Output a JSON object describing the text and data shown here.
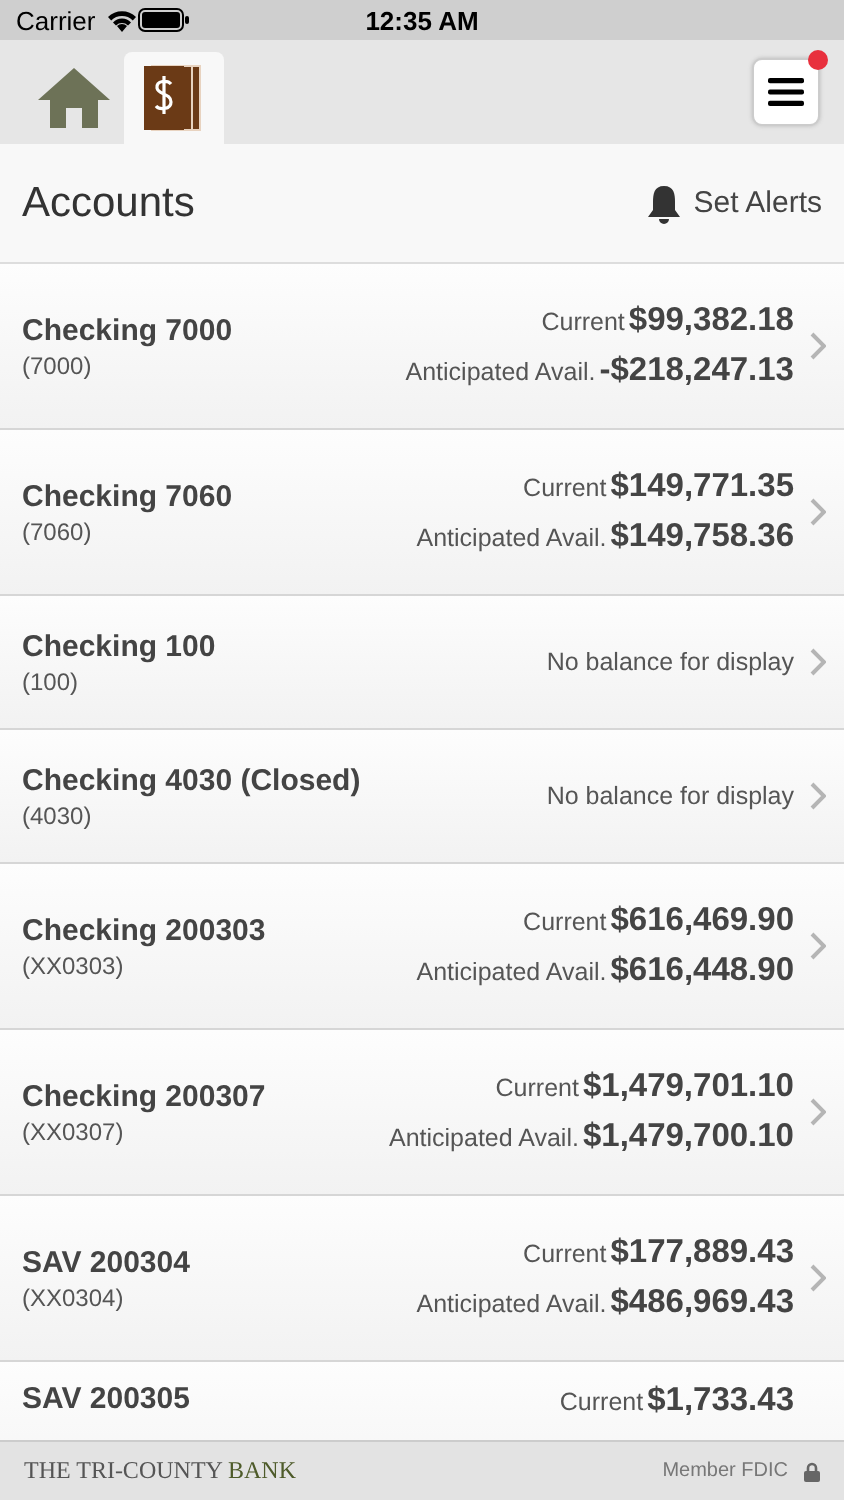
{
  "status_bar": {
    "carrier": "Carrier",
    "time": "12:35 AM"
  },
  "nav": {
    "tabs": [
      {
        "kind": "home",
        "selected": false
      },
      {
        "kind": "accounts",
        "selected": true
      }
    ],
    "menu_badge": true
  },
  "header": {
    "title": "Accounts",
    "action": "Set Alerts"
  },
  "accounts": [
    {
      "name": "Checking 7000",
      "number": "(7000)",
      "kind": "balances",
      "lines": [
        {
          "label": "Current",
          "amount": "$99,382.18"
        },
        {
          "label": "Anticipated Avail.",
          "amount": "-$218,247.13"
        }
      ]
    },
    {
      "name": "Checking 7060",
      "number": "(7060)",
      "kind": "balances",
      "lines": [
        {
          "label": "Current",
          "amount": "$149,771.35"
        },
        {
          "label": "Anticipated Avail.",
          "amount": "$149,758.36"
        }
      ]
    },
    {
      "name": "Checking 100",
      "number": "(100)",
      "kind": "message",
      "message": "No balance for display"
    },
    {
      "name": "Checking 4030 (Closed)",
      "number": "(4030)",
      "kind": "message",
      "message": "No balance for display"
    },
    {
      "name": "Checking 200303",
      "number": "(XX0303)",
      "kind": "balances",
      "lines": [
        {
          "label": "Current",
          "amount": "$616,469.90"
        },
        {
          "label": "Anticipated Avail.",
          "amount": "$616,448.90"
        }
      ]
    },
    {
      "name": "Checking 200307",
      "number": "(XX0307)",
      "kind": "balances",
      "lines": [
        {
          "label": "Current",
          "amount": "$1,479,701.10"
        },
        {
          "label": "Anticipated Avail.",
          "amount": "$1,479,700.10"
        }
      ]
    },
    {
      "name": "SAV 200304",
      "number": "(XX0304)",
      "kind": "balances",
      "lines": [
        {
          "label": "Current",
          "amount": "$177,889.43"
        },
        {
          "label": "Anticipated Avail.",
          "amount": "$486,969.43"
        }
      ]
    },
    {
      "name": "SAV 200305",
      "kind": "balances",
      "lines": [
        {
          "label": "Current",
          "amount": "$1,733.43"
        }
      ]
    }
  ],
  "footer": {
    "bank_name": "THE TRI-COUNTY",
    "bank_suffix": "BANK",
    "fdic": "Member FDIC"
  }
}
